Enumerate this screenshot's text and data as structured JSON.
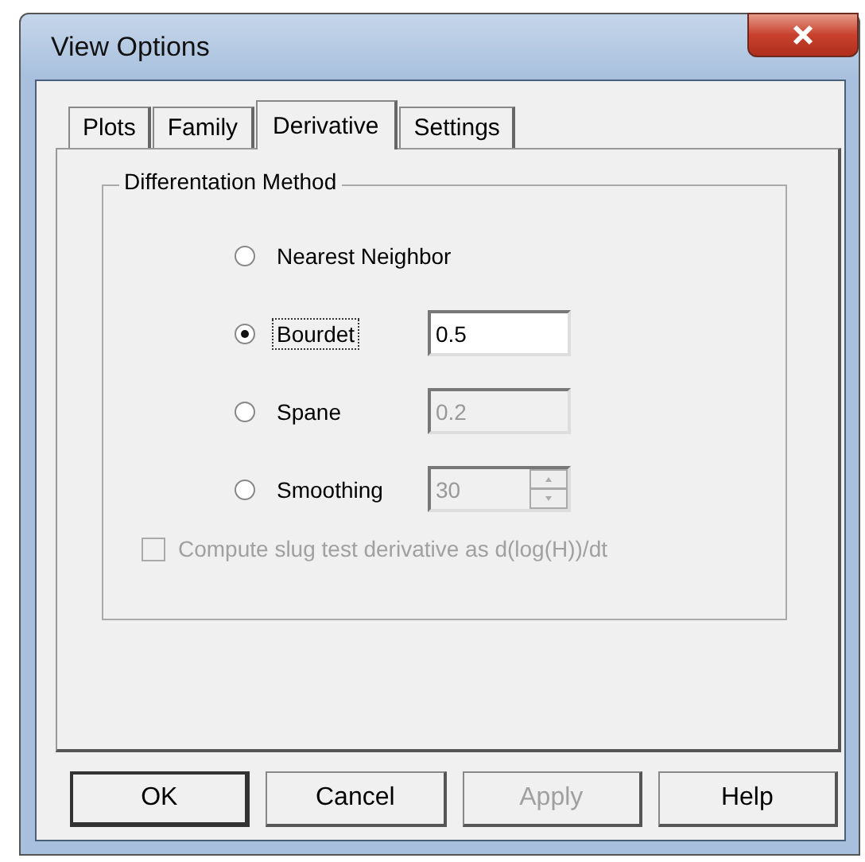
{
  "window": {
    "title": "View Options"
  },
  "tabs": [
    {
      "label": "Plots",
      "selected": false
    },
    {
      "label": "Family",
      "selected": false
    },
    {
      "label": "Derivative",
      "selected": true
    },
    {
      "label": "Settings",
      "selected": false
    }
  ],
  "group": {
    "title": "Differentation Method",
    "options": [
      {
        "kind": "plain",
        "label": "Nearest Neighbor",
        "selected": false,
        "focused": false
      },
      {
        "kind": "field",
        "label": "Bourdet",
        "selected": true,
        "focused": true,
        "value": "0.5",
        "disabled": false
      },
      {
        "kind": "field",
        "label": "Spane",
        "selected": false,
        "focused": false,
        "value": "0.2",
        "disabled": true
      },
      {
        "kind": "spinner",
        "label": "Smoothing",
        "selected": false,
        "focused": false,
        "value": "30",
        "disabled": true
      }
    ]
  },
  "checkbox": {
    "label": "Compute slug test derivative as d(log(H))/dt",
    "checked": false,
    "disabled": true
  },
  "buttons": [
    {
      "label": "OK",
      "disabled": false,
      "default": true
    },
    {
      "label": "Cancel",
      "disabled": false,
      "default": false
    },
    {
      "label": "Apply",
      "disabled": true,
      "default": false
    },
    {
      "label": "Help",
      "disabled": false,
      "default": false
    }
  ]
}
